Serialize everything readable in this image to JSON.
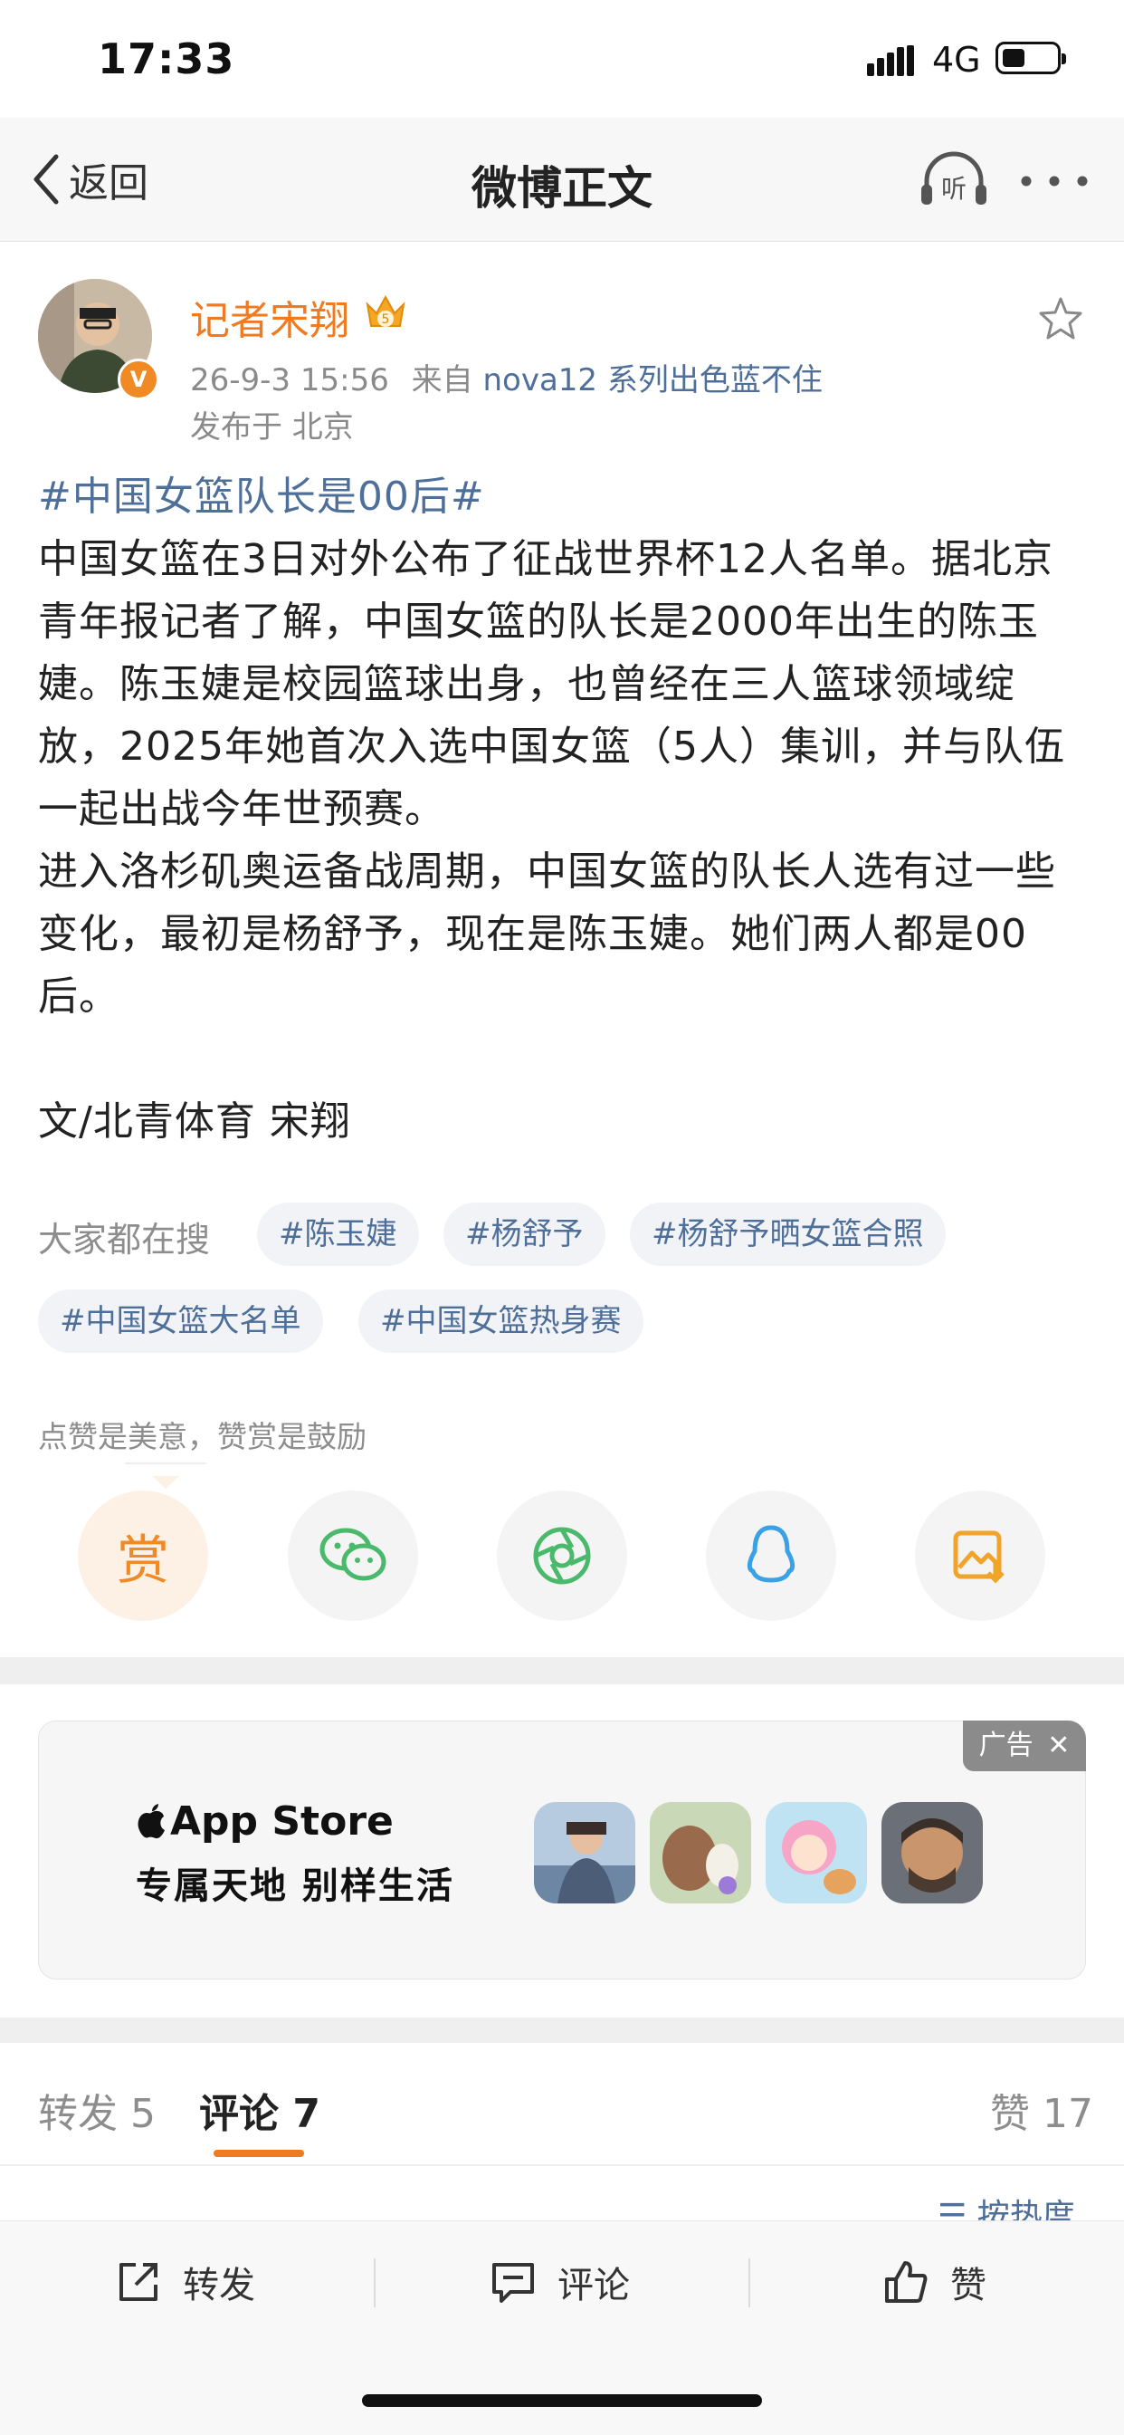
{
  "status_bar": {
    "time": "17:33",
    "network": "4G"
  },
  "nav": {
    "back_label": "返回",
    "title": "微博正文"
  },
  "listen_label": "听",
  "author": {
    "name": "记者宋翔",
    "badge": "V",
    "crown_level": "5",
    "time": "26-9-3 15:56",
    "from_label": "来自",
    "source": "nova12 系列出色蓝不住",
    "location": "发布于 北京"
  },
  "post": {
    "topic": "#中国女篮队长是00后#",
    "paragraph1": "中国女篮在3日对外公布了征战世界杯12人名单。据北京青年报记者了解，中国女篮的队长是2000年出生的陈玉婕。陈玉婕是校园篮球出身，也曾经在三人篮球领域绽放，2025年她首次入选中国女篮（5人）集训，并与队伍一起出战今年世预赛。",
    "paragraph2": "进入洛杉矶奥运备战周期，中国女篮的队长人选有过一些变化，最初是杨舒予，现在是陈玉婕。她们两人都是00后。",
    "signature": "文/北青体育 宋翔"
  },
  "search": {
    "label": "大家都在搜",
    "tags": [
      "#陈玉婕",
      "#杨舒予",
      "#杨舒予晒女篮合照",
      "#中国女篮大名单",
      "#中国女篮热身赛"
    ]
  },
  "reward": {
    "caption": "点赞是美意，赞赏是鼓励",
    "button": "赏"
  },
  "share_icons": [
    "reward-icon",
    "wechat-icon",
    "moments-icon",
    "qq-icon",
    "save-image-icon"
  ],
  "ad": {
    "label": "广告",
    "brand": "App Store",
    "slogan": "专属天地 别样生活",
    "apps": [
      "game-app-1",
      "game-app-2",
      "game-app-3",
      "game-app-4"
    ]
  },
  "tabs": [
    {
      "label": "转发 5"
    },
    {
      "label": "评论 7"
    },
    {
      "label": "赞 17"
    }
  ],
  "sort_label": "按热度",
  "bottom_bar": {
    "repost": "转发",
    "comment": "评论",
    "like": "赞"
  },
  "colors": {
    "accent": "#f07a1f",
    "link": "#4e6f99",
    "muted": "#8d8d8d"
  }
}
